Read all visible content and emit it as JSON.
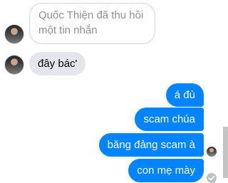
{
  "conversation": {
    "recalled_notice": "Quốc Thiện đã thu hồi một tin nhắn",
    "incoming_messages": [
      {
        "text": "đây bác'"
      }
    ],
    "outgoing_messages": [
      {
        "text": "á đù"
      },
      {
        "text": "scam chúa"
      },
      {
        "text": "băng đảng scam à"
      },
      {
        "text": "con mẹ mày"
      }
    ]
  },
  "icons": {
    "sender_avatar": "avatar",
    "seen_indicator": "seen-avatar-icon",
    "sent_status": "check-circle-icon"
  },
  "colors": {
    "outgoing_bubble": "#0084ff",
    "incoming_bubble": "#e4e6eb",
    "recalled_border": "#d3d6db"
  }
}
